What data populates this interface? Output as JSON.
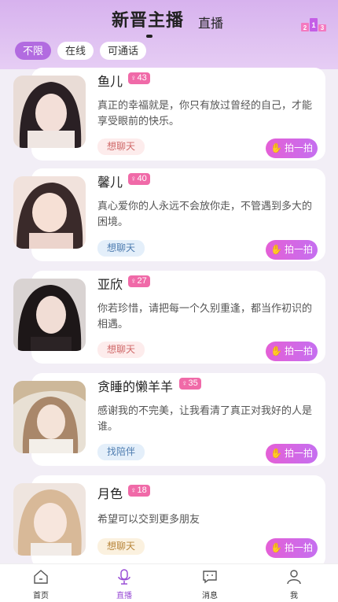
{
  "header": {
    "tabs": [
      {
        "label": "新晋主播"
      },
      {
        "label": "直播"
      }
    ],
    "rank_icon": "ranking-podium-icon",
    "rank_icon_text": "2 1 3"
  },
  "filters": [
    {
      "label": "不限",
      "active": true
    },
    {
      "label": "在线",
      "active": false
    },
    {
      "label": "可通话",
      "active": false
    }
  ],
  "users": [
    {
      "name": "鱼儿",
      "age": "43",
      "bio": "真正的幸福就是，你只有放过曾经的自己，才能享受眼前的快乐。",
      "tag": "想聊天",
      "tag_color": "pink",
      "action": "拍一拍"
    },
    {
      "name": "馨儿",
      "age": "40",
      "bio": "真心爱你的人永远不会放你走，不管遇到多大的困境。",
      "tag": "想聊天",
      "tag_color": "blue",
      "action": "拍一拍"
    },
    {
      "name": "亚欣",
      "age": "27",
      "bio": "你若珍惜，请把每一个久别重逢，都当作初识的相遇。",
      "tag": "想聊天",
      "tag_color": "pink",
      "action": "拍一拍"
    },
    {
      "name": "贪睡的懒羊羊",
      "age": "35",
      "bio": "感谢我的不完美，让我看清了真正对我好的人是谁。",
      "tag": "找陪伴",
      "tag_color": "blue",
      "action": "拍一拍"
    },
    {
      "name": "月色",
      "age": "18",
      "bio": "希望可以交到更多朋友",
      "tag": "想聊天",
      "tag_color": "yellow",
      "action": "拍一拍"
    }
  ],
  "gender_symbol": "♀",
  "bottom_nav": [
    {
      "label": "首页",
      "icon": "home-icon",
      "active": false
    },
    {
      "label": "直播",
      "icon": "microphone-icon",
      "active": true
    },
    {
      "label": "消息",
      "icon": "message-icon",
      "active": false
    },
    {
      "label": "我",
      "icon": "person-icon",
      "active": false
    }
  ],
  "colors": {
    "accent": "#b26be0",
    "age_badge": "#f06aa8",
    "action_button": "#d766e3"
  }
}
